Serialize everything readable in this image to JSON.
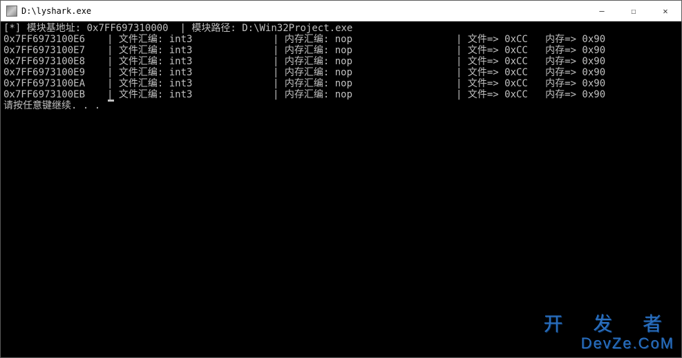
{
  "window": {
    "title": "D:\\lyshark.exe",
    "controls": {
      "minimize": "—",
      "maximize": "☐",
      "close": "✕"
    }
  },
  "header": {
    "prefix": "[*]",
    "base_label": "模块基地址:",
    "base_addr": "0x7FF697310000",
    "path_label": "模块路径:",
    "path": "D:\\Win32Project.exe"
  },
  "labels": {
    "file_asm": "文件汇编:",
    "mem_asm": "内存汇编:",
    "file_byte": "文件=>",
    "mem_byte": "内存=>"
  },
  "rows": [
    {
      "addr": "0x7FF6973100E6",
      "file_asm": "int3",
      "mem_asm": "nop",
      "file_byte": "0xCC",
      "mem_byte": "0x90"
    },
    {
      "addr": "0x7FF6973100E7",
      "file_asm": "int3",
      "mem_asm": "nop",
      "file_byte": "0xCC",
      "mem_byte": "0x90"
    },
    {
      "addr": "0x7FF6973100E8",
      "file_asm": "int3",
      "mem_asm": "nop",
      "file_byte": "0xCC",
      "mem_byte": "0x90"
    },
    {
      "addr": "0x7FF6973100E9",
      "file_asm": "int3",
      "mem_asm": "nop",
      "file_byte": "0xCC",
      "mem_byte": "0x90"
    },
    {
      "addr": "0x7FF6973100EA",
      "file_asm": "int3",
      "mem_asm": "nop",
      "file_byte": "0xCC",
      "mem_byte": "0x90"
    },
    {
      "addr": "0x7FF6973100EB",
      "file_asm": "int3",
      "mem_asm": "nop",
      "file_byte": "0xCC",
      "mem_byte": "0x90"
    }
  ],
  "footer": {
    "press_any_key": "请按任意键继续. . . "
  },
  "watermark": {
    "line1": "开 发 者",
    "line2": "DevZe.CoM"
  }
}
